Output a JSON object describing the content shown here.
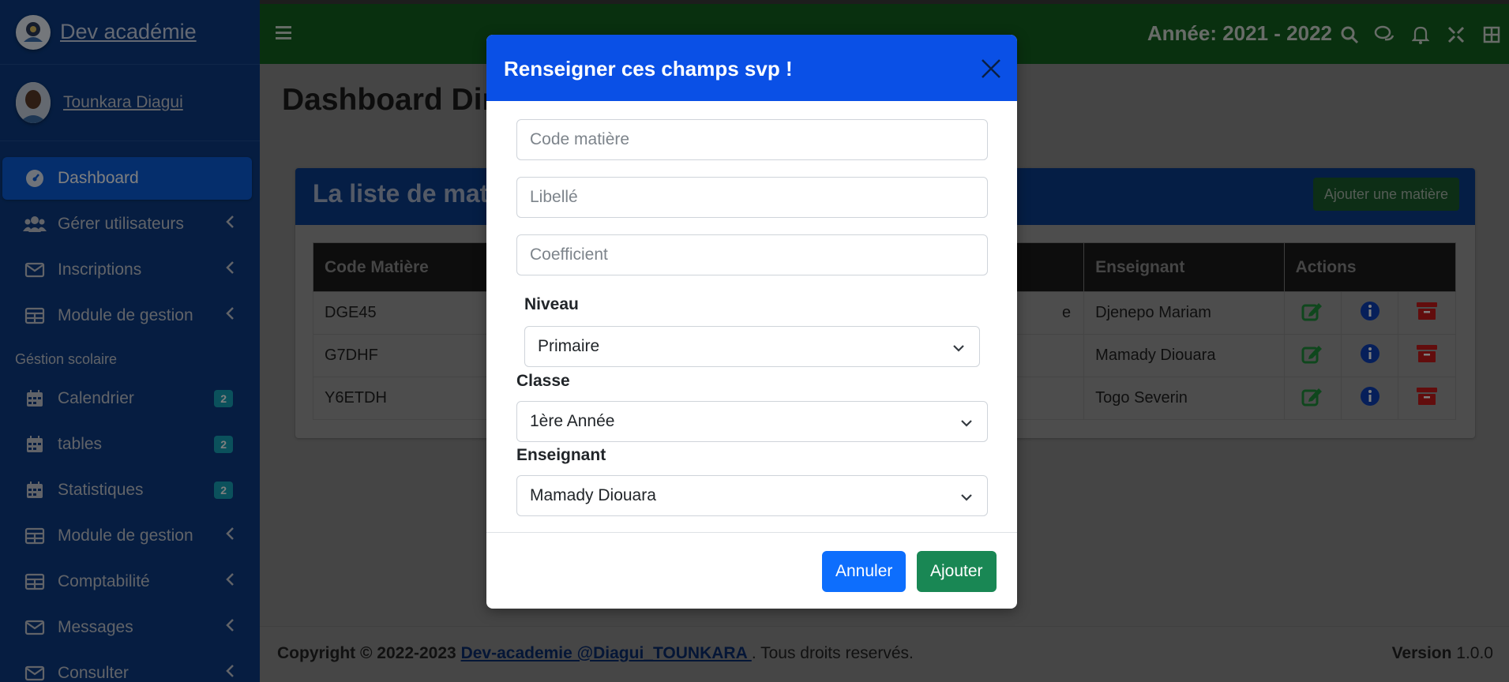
{
  "brand": {
    "name": "Dev académie"
  },
  "user": {
    "name": "Tounkara Diagui"
  },
  "sidebar": {
    "items": [
      {
        "label": "Dashboard",
        "icon": "tachometer-icon",
        "active": true
      },
      {
        "label": "Gérer utilisateurs",
        "icon": "users-icon"
      },
      {
        "label": "Inscriptions",
        "icon": "envelope-icon"
      },
      {
        "label": "Module de gestion",
        "icon": "table-icon"
      }
    ],
    "section_header": "Géstion scolaire",
    "items2": [
      {
        "label": "Calendrier",
        "icon": "calendar-icon",
        "badge": "2"
      },
      {
        "label": "tables",
        "icon": "calendar-icon",
        "badge": "2"
      },
      {
        "label": "Statistiques",
        "icon": "calendar-icon",
        "badge": "2"
      },
      {
        "label": "Module de gestion",
        "icon": "table-icon"
      },
      {
        "label": "Comptabilité",
        "icon": "table-icon"
      },
      {
        "label": "Messages",
        "icon": "envelope-icon"
      },
      {
        "label": "Consulter",
        "icon": "envelope-icon"
      }
    ]
  },
  "topbar": {
    "year": "Année: 2021 - 2022"
  },
  "page": {
    "title": "Dashboard Dire"
  },
  "card": {
    "title": "La liste de mati",
    "add_button": "Ajouter une matière",
    "columns": [
      "Code Matière",
      "Enseignant",
      "Actions"
    ],
    "rows": [
      {
        "code": "DGE45",
        "mid": "e",
        "teacher": "Djenepo Mariam"
      },
      {
        "code": "G7DHF",
        "mid": "",
        "teacher": "Mamady Diouara"
      },
      {
        "code": "Y6ETDH",
        "mid": "",
        "teacher": "Togo Severin"
      }
    ]
  },
  "footer": {
    "copyright": "Copyright © 2022-2023 ",
    "link": "Dev-academie @Diagui_TOUNKARA ",
    "rights": ". Tous droits reservés.",
    "version_label": "Version",
    "version": "1.0.0"
  },
  "modal": {
    "title": "Renseigner ces champs svp !",
    "code_placeholder": "Code matière",
    "libelle_placeholder": "Libellé",
    "coef_placeholder": "Coefficient",
    "niveau_label": "Niveau",
    "niveau_value": "Primaire",
    "classe_label": "Classe",
    "classe_value": "1ère Année",
    "enseignant_label": "Enseignant",
    "enseignant_value": "Mamady Diouara",
    "cancel": "Annuler",
    "submit": "Ajouter"
  },
  "colors": {
    "sidebar": "#0c3b82",
    "topbar": "#12611e",
    "modal_header": "#0a50e6",
    "primary": "#0d6efd",
    "success": "#198754",
    "badge": "#17a2b8"
  }
}
